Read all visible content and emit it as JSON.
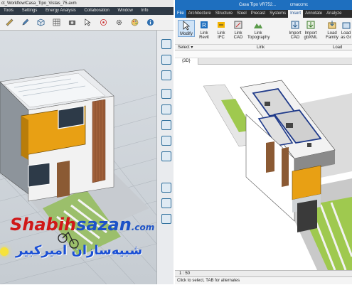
{
  "left_app": {
    "title": "ct_Workflow/Casa_Tipo_Vistas_75.avm",
    "menu": [
      "Tools",
      "Settings",
      "Energy Analysis",
      "Collaboration",
      "Window",
      "Info"
    ],
    "toolbar_icons": [
      "measure-icon",
      "pencil-icon",
      "cube-icon",
      "grid-icon",
      "camera-icon",
      "cursor-icon",
      "target-icon",
      "gear-icon",
      "palette-icon"
    ],
    "sidebar_icons": [
      "navigate-cube-icon",
      "cube-icon",
      "pan-icon",
      "orbit-icon",
      "walk-icon",
      "look-icon",
      "zoom-in-icon",
      "zoom-out-icon",
      "fit-icon"
    ]
  },
  "right_app": {
    "title": "Casa Tipo VR752...",
    "user": "cmaccmc",
    "tabs": [
      "File",
      "Architecture",
      "Structure",
      "Steel",
      "Precast",
      "Systems",
      "Insert",
      "Annotate",
      "Analyze"
    ],
    "active_tab": "Insert",
    "ribbon": [
      {
        "line1": "Modify",
        "line2": ""
      },
      {
        "line1": "Link",
        "line2": "Revit"
      },
      {
        "line1": "Link",
        "line2": "IFC"
      },
      {
        "line1": "Link",
        "line2": "CAD"
      },
      {
        "line1": "Link",
        "line2": "Topography"
      },
      {
        "line1": "Import",
        "line2": "CAD"
      },
      {
        "line1": "Import",
        "line2": "gbXML"
      },
      {
        "line1": "Load",
        "line2": "Family"
      },
      {
        "line1": "Load",
        "line2": "as Gr"
      }
    ],
    "ribbon_footer": {
      "select": "Select ▾",
      "link": "Link",
      "load": "Load"
    },
    "view_tab": "{3D}",
    "scale": "1 : 50",
    "status": "Click to select, TAB for alternates"
  },
  "watermark": {
    "latin_red": "Shabih",
    "latin_blue": "sazan",
    "latin_domain": ".com",
    "persian": "شبیه‌سازان امیرکبیر"
  },
  "colors": {
    "accent": "#1e6fbf",
    "orange": "#e8a014",
    "green": "#7cc340",
    "brand_red": "#d01818",
    "brand_blue": "#1c52c7"
  }
}
